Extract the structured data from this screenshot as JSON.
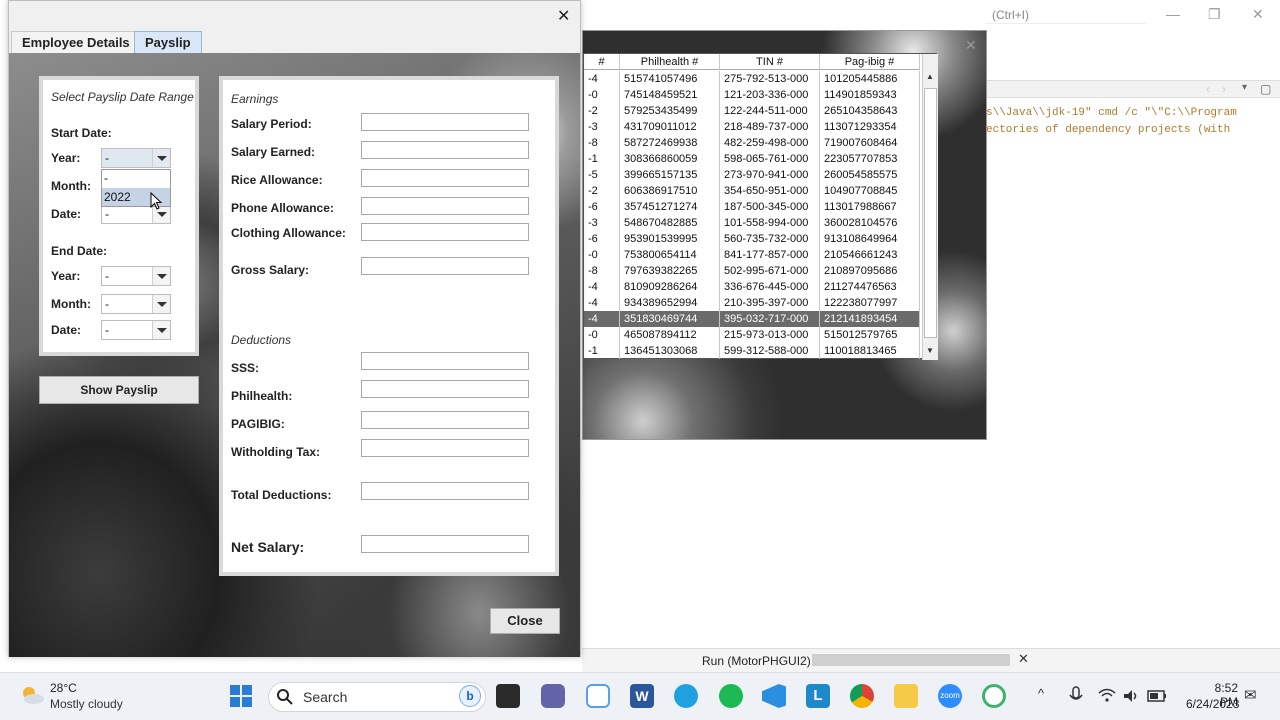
{
  "ide": {
    "search_hint": "(Ctrl+I)",
    "console_lines": [
      "s\\\\Java\\\\jdk-19\" cmd /c \"\\\"C:\\\\Program",
      "ectories of dependency projects (with"
    ],
    "status_run": "Run (MotorPHGUI2)"
  },
  "table": {
    "columns": [
      "#",
      "Philhealth #",
      "TIN #",
      "Pag-ibig #"
    ],
    "rows": [
      [
        "-4",
        "515741057496",
        "275-792-513-000",
        "101205445886"
      ],
      [
        "-0",
        "745148459521",
        "121-203-336-000",
        "114901859343"
      ],
      [
        "-2",
        "579253435499",
        "122-244-511-000",
        "265104358643"
      ],
      [
        "-3",
        "431709011012",
        "218-489-737-000",
        "113071293354"
      ],
      [
        "-8",
        "587272469938",
        "482-259-498-000",
        "719007608464"
      ],
      [
        "-1",
        "308366860059",
        "598-065-761-000",
        "223057707853"
      ],
      [
        "-5",
        "399665157135",
        "273-970-941-000",
        "260054585575"
      ],
      [
        "-2",
        "606386917510",
        "354-650-951-000",
        "104907708845"
      ],
      [
        "-6",
        "357451271274",
        "187-500-345-000",
        "113017988667"
      ],
      [
        "-3",
        "548670482885",
        "101-558-994-000",
        "360028104576"
      ],
      [
        "-6",
        "953901539995",
        "560-735-732-000",
        "913108649964"
      ],
      [
        "-0",
        "753800654114",
        "841-177-857-000",
        "210546661243"
      ],
      [
        "-8",
        "797639382265",
        "502-995-671-000",
        "210897095686"
      ],
      [
        "-4",
        "810909286264",
        "336-676-445-000",
        "211274476563"
      ],
      [
        "-4",
        "934389652994",
        "210-395-397-000",
        "122238077997"
      ],
      [
        "-4",
        "351830469744",
        "395-032-717-000",
        "212141893454"
      ],
      [
        "-0",
        "465087894112",
        "215-973-013-000",
        "515012579765"
      ],
      [
        "-1",
        "136451303068",
        "599-312-588-000",
        "110018813465"
      ]
    ],
    "selected_row": 15
  },
  "dialog": {
    "close_glyph": "✕",
    "tabs": [
      "Employee Details",
      "Payslip"
    ],
    "active_tab": 1,
    "range": {
      "title": "Select Payslip Date Range",
      "start_label": "Start Date:",
      "end_label": "End Date:",
      "year_label": "Year:",
      "month_label": "Month:",
      "date_label": "Date:",
      "start_year": "-",
      "start_month": "-",
      "start_date": "-",
      "end_year": "-",
      "end_month": "-",
      "end_date": "-",
      "dropdown_options": [
        "-",
        "2022"
      ],
      "dropdown_highlight": "2022"
    },
    "show_button": "Show Payslip",
    "earnings": {
      "section": "Earnings",
      "salary_period": "Salary Period:",
      "salary_earned": "Salary Earned:",
      "rice": "Rice Allowance:",
      "phone": "Phone Allowance:",
      "clothing": "Clothing Allowance:",
      "gross": "Gross Salary:"
    },
    "deductions": {
      "section": "Deductions",
      "sss": "SSS:",
      "philhealth": "Philhealth:",
      "pagibig": "PAGIBIG:",
      "tax": "Witholding Tax:",
      "total": "Total Deductions:",
      "net": "Net Salary:"
    },
    "close_button": "Close"
  },
  "taskbar": {
    "weather_temp": "28°C",
    "weather_desc": "Mostly cloudy",
    "search_placeholder": "Search",
    "time": "8:52 PM",
    "date": "6/24/2023",
    "icons": [
      "windows-start-icon",
      "search-icon",
      "bing-icon",
      "file-explorer-dark-icon",
      "teams-icon",
      "app-hex-icon",
      "word-icon",
      "edge-icon",
      "spotify-icon",
      "vscode-icon",
      "l-app-icon",
      "chrome-icon",
      "folder-icon",
      "zoom-icon",
      "circle-app-icon"
    ]
  }
}
